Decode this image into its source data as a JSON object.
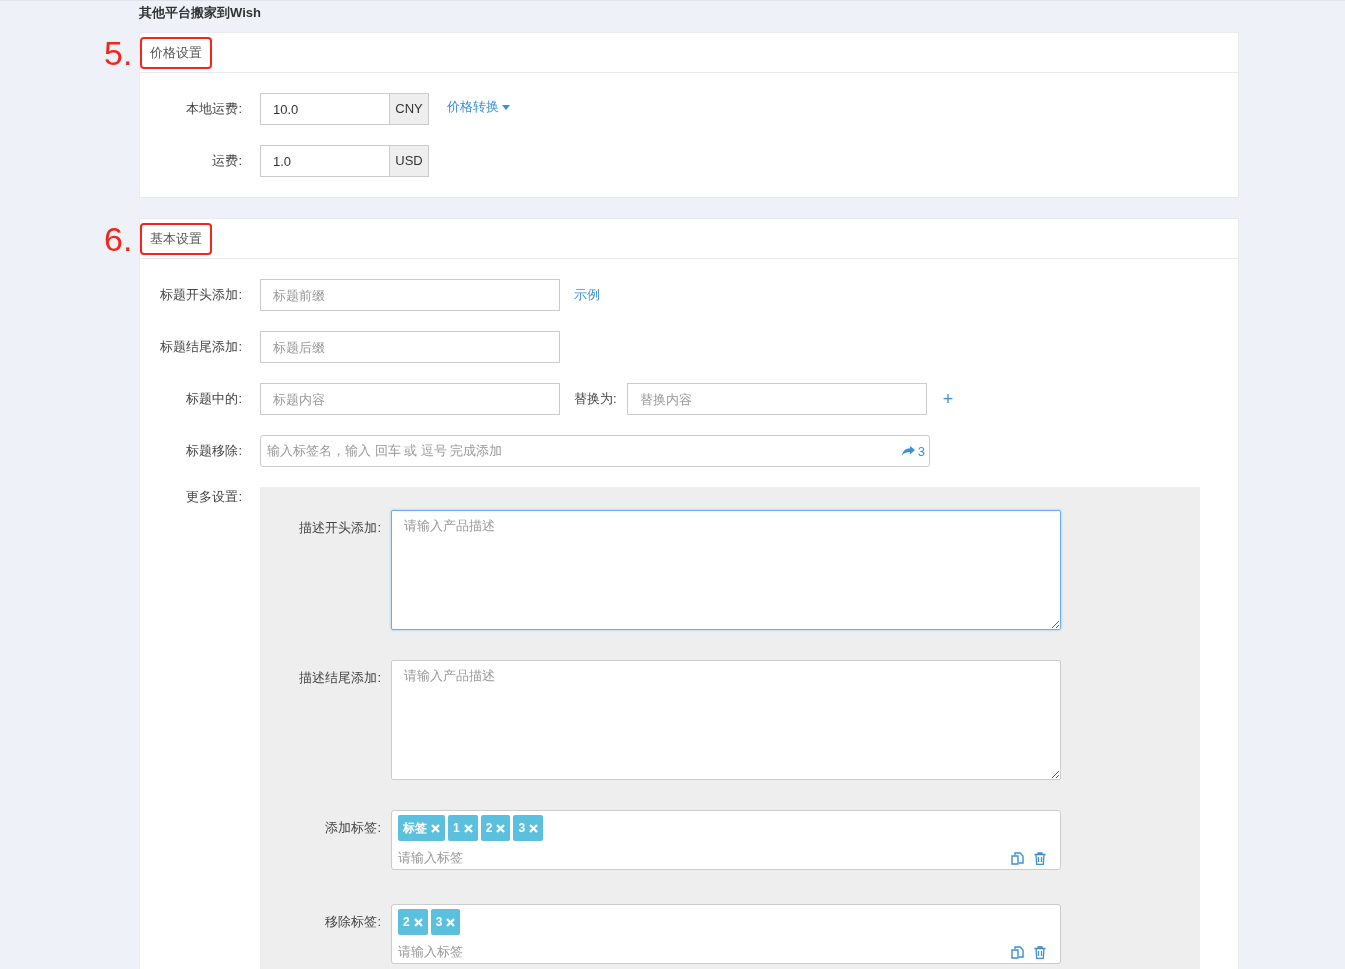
{
  "page_title": "其他平台搬家到Wish",
  "price_section": {
    "number": "5.",
    "title": "价格设置",
    "local_shipping": {
      "label": "本地运费:",
      "value": "10.0",
      "unit": "CNY"
    },
    "convert_link": "价格转换",
    "shipping": {
      "label": "运费:",
      "value": "1.0",
      "unit": "USD"
    }
  },
  "basic_section": {
    "number": "6.",
    "title": "基本设置",
    "title_prefix": {
      "label": "标题开头添加:",
      "placeholder": "标题前缀"
    },
    "example_link": "示例",
    "title_suffix": {
      "label": "标题结尾添加:",
      "placeholder": "标题后缀"
    },
    "title_replace": {
      "label": "标题中的:",
      "placeholder": "标题内容",
      "replace_label": "替换为:",
      "replace_placeholder": "替换内容",
      "add": "+"
    },
    "title_remove": {
      "label": "标题移除:",
      "placeholder": "输入标签名，输入 回车 或 逗号 完成添加",
      "count": "3"
    },
    "more": {
      "label": "更多设置:",
      "desc_prefix": {
        "label": "描述开头添加:",
        "placeholder": "请输入产品描述",
        "focused": true
      },
      "desc_suffix": {
        "label": "描述结尾添加:",
        "placeholder": "请输入产品描述",
        "focused": false
      },
      "add_tags": {
        "label": "添加标签:",
        "tags": [
          "标签",
          "1",
          "2",
          "3"
        ],
        "placeholder": "请输入标签"
      },
      "remove_tags": {
        "label": "移除标签:",
        "tags": [
          "2",
          "3"
        ],
        "placeholder": "请输入标签"
      }
    }
  }
}
